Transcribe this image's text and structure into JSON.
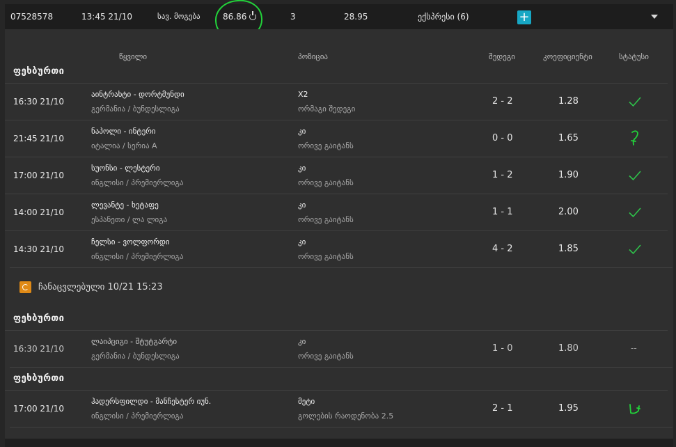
{
  "summary": {
    "ticket_id": "07528578",
    "datetime": "13:45 21/10",
    "potential_win_label": "სავ. მოგება",
    "amount": "86.86",
    "selections_count": "3",
    "total_odds": "28.95",
    "bet_type": "ექსპრესი (6)",
    "plus_label": "+"
  },
  "columns": {
    "event": "წყვილი",
    "position": "პოზიცია",
    "result": "შედეგი",
    "odds": "კოეფიციენტი",
    "status": "სტატუსი"
  },
  "sections": [
    {
      "sport": "ფეხბურთი",
      "rows": [
        {
          "time": "16:30 21/10",
          "teams": "აინტრახტი - დორტმუნდი",
          "league": "გერმანია / ბუნდესლიგა",
          "pick": "X2",
          "market": "ორმაგი შედეგი",
          "score": "2 - 2",
          "odds": "1.28",
          "status": "won"
        },
        {
          "time": "21:45 21/10",
          "teams": "ნაპოლი - ინტერი",
          "league": "იტალია / სერია A",
          "pick": "კი",
          "market": "ორივე გაიტანს",
          "score": "0 - 0",
          "odds": "1.65",
          "status": "marked"
        },
        {
          "time": "17:00 21/10",
          "teams": "სუონსი - ლესტერი",
          "league": "ინგლისი / პრემიერლიგა",
          "pick": "კი",
          "market": "ორივე გაიტანს",
          "score": "1 - 2",
          "odds": "1.90",
          "status": "won"
        },
        {
          "time": "14:00 21/10",
          "teams": "ლევანტე - ხეტაფე",
          "league": "ესპანეთი / ლა ლიგა",
          "pick": "კი",
          "market": "ორივე გაიტანს",
          "score": "1 - 1",
          "odds": "2.00",
          "status": "won"
        },
        {
          "time": "14:30 21/10",
          "teams": "ჩელსი - ვოლფორდი",
          "league": "ინგლისი / პრემიერლიგა",
          "pick": "კი",
          "market": "ორივე გაიტანს",
          "score": "4 - 2",
          "odds": "1.85",
          "status": "won"
        }
      ]
    }
  ],
  "replaced_notice": "ჩანაცვლებული 10/21 15:23",
  "replaced_sections": [
    {
      "sport": "ფეხბურთი",
      "rows": [
        {
          "time": "16:30 21/10",
          "teams": "ლაიპციგი - შტუტგარტი",
          "league": "გერმანია / ბუნდესლიგა",
          "pick": "კი",
          "market": "ორივე გაიტანს",
          "score": "1 - 0",
          "odds": "1.80",
          "status_text": "--"
        }
      ]
    },
    {
      "sport": "ფეხბურთი",
      "rows": [
        {
          "time": "17:00 21/10",
          "teams": "ჰადერსფილდი - მანჩესტერ იუნ.",
          "league": "ინგლისი / პრემიერლიგა",
          "pick": "მეტი",
          "market": "გოლების რაოდენობა 2.5",
          "score": "2 - 1",
          "odds": "1.95",
          "status": "marked"
        }
      ]
    }
  ],
  "colors": {
    "check": "#2ec24a",
    "handwriting": "#22d23a",
    "accent": "#17a7c4",
    "replace": "#e08a16"
  }
}
